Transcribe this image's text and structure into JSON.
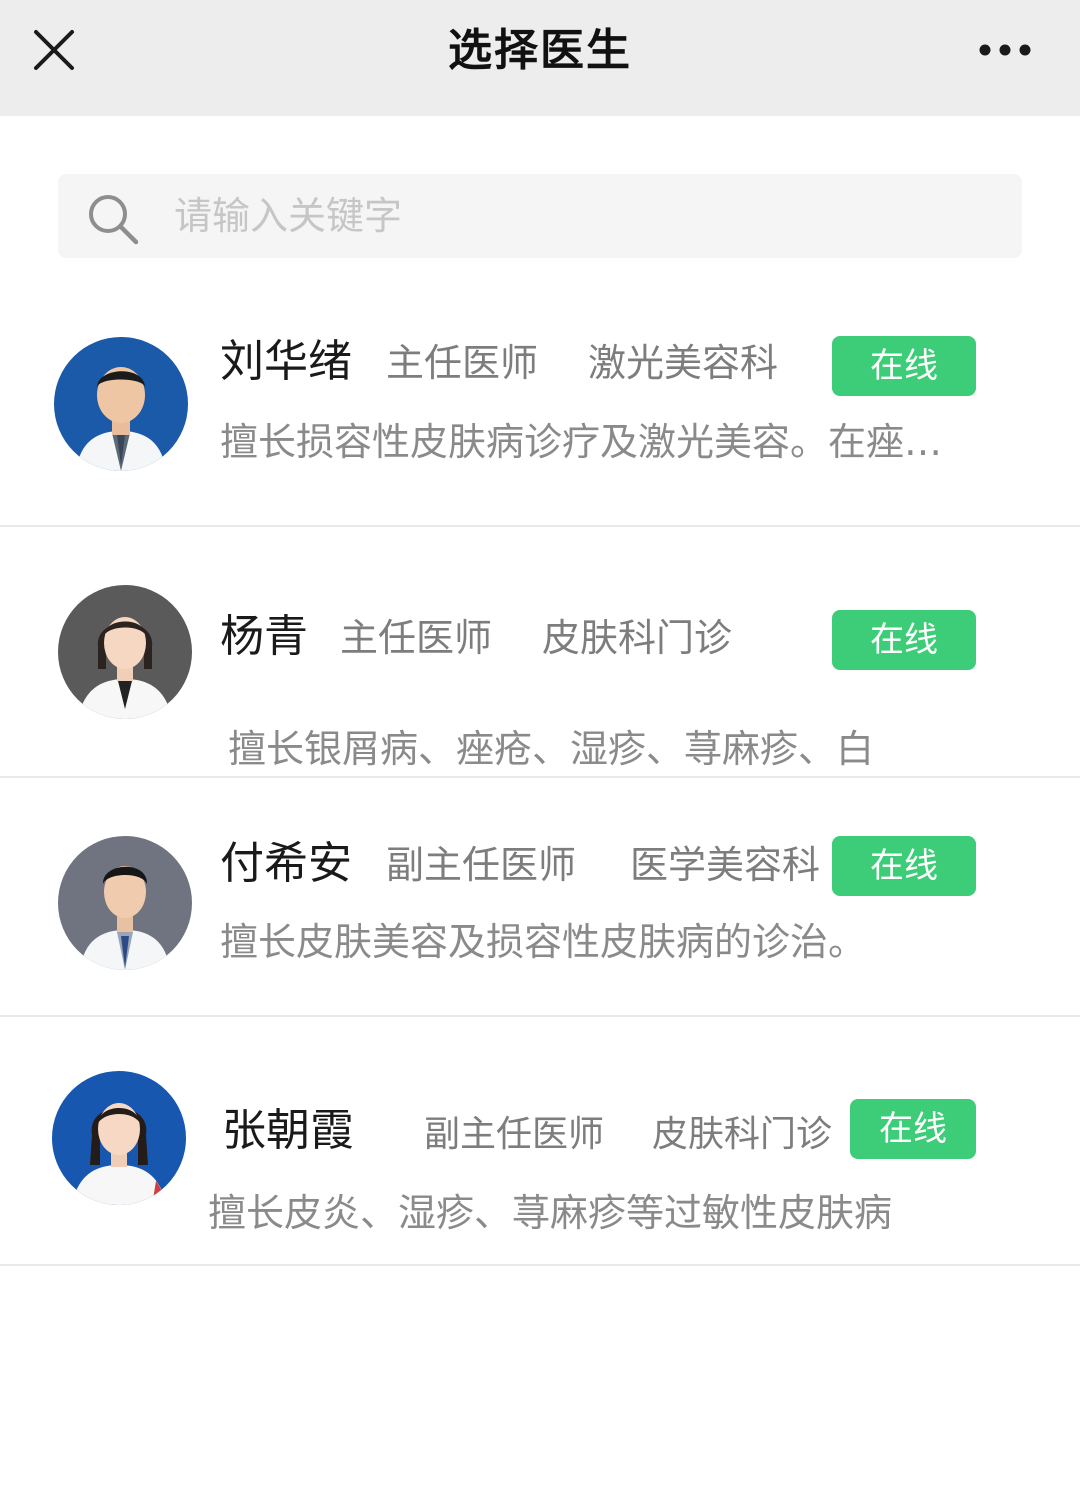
{
  "header": {
    "title": "选择医生"
  },
  "search": {
    "placeholder": "请输入关键字"
  },
  "colors": {
    "online_badge": "#3dcd78",
    "header_bg": "#ededed"
  },
  "doctors": [
    {
      "name": "刘华绪",
      "title": "主任医师",
      "department": "激光美容科",
      "status": "在线",
      "description": "擅长损容性皮肤病诊疗及激光美容。在痤…"
    },
    {
      "name": "杨青",
      "title": "主任医师",
      "department": "皮肤科门诊",
      "status": "在线",
      "description": "擅长银屑病、痤疮、湿疹、荨麻疹、白"
    },
    {
      "name": "付希安",
      "title": "副主任医师",
      "department": "医学美容科",
      "status": "在线",
      "description": "擅长皮肤美容及损容性皮肤病的诊治。"
    },
    {
      "name": "张朝霞",
      "title": "副主任医师",
      "department": "皮肤科门诊",
      "status": "在线",
      "description": "擅长皮炎、湿疹、荨麻疹等过敏性皮肤病"
    }
  ]
}
